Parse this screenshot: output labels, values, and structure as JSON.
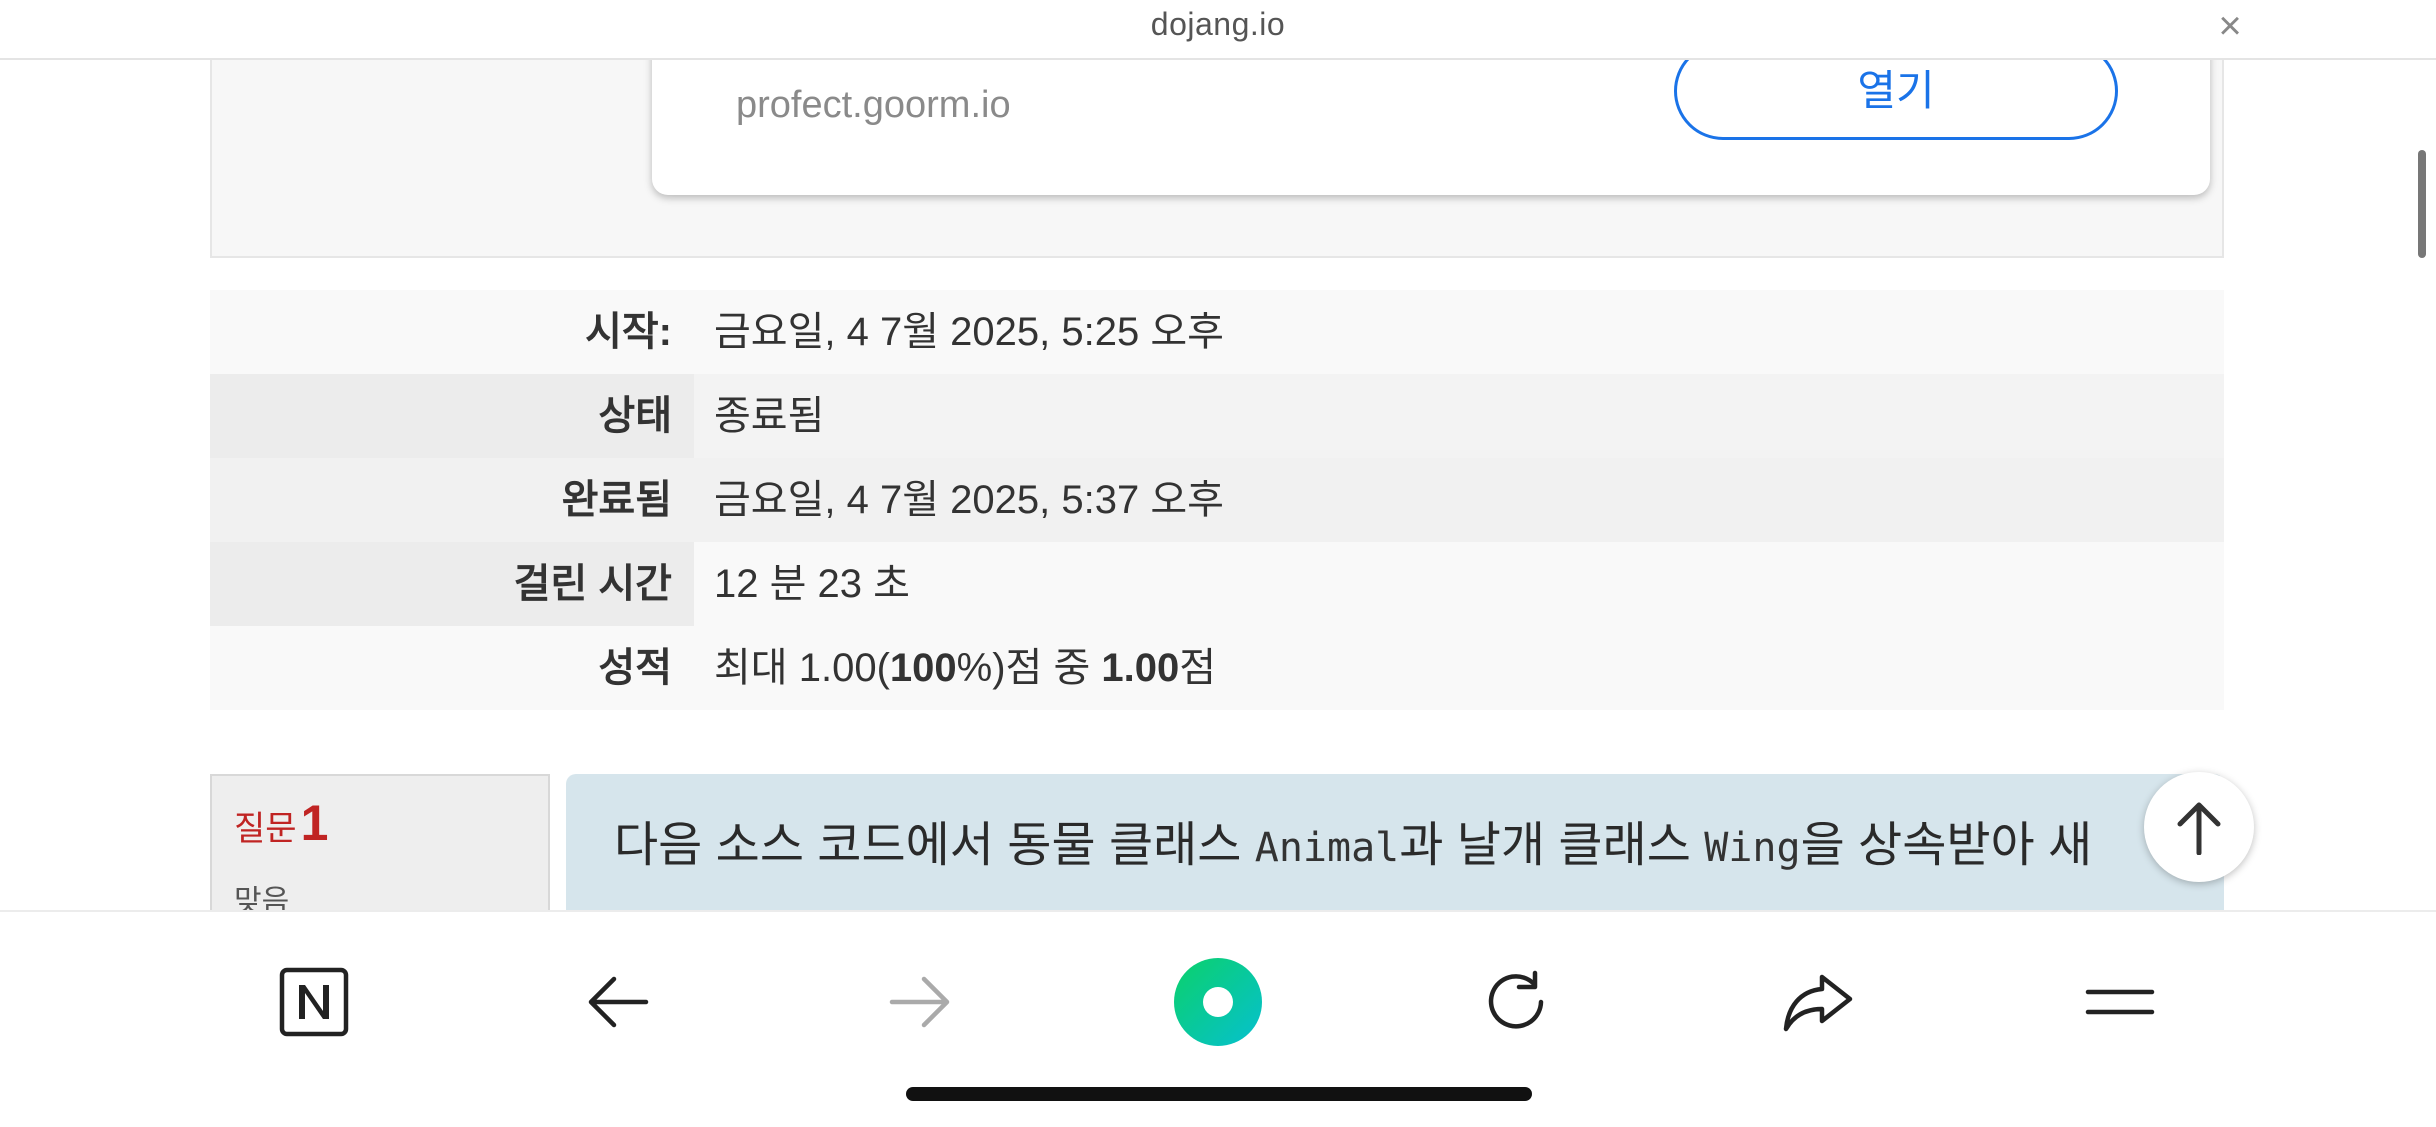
{
  "browser": {
    "url": "dojang.io",
    "close_label": "×"
  },
  "ad": {
    "domain": "profect.goorm.io",
    "open_label": "열기"
  },
  "summary": [
    {
      "label": "시작:",
      "value": "금요일, 4 7월 2025, 5:25 오후"
    },
    {
      "label": "상태",
      "value": "종료됨"
    },
    {
      "label": "완료됨",
      "value": "금요일, 4 7월 2025, 5:37 오후"
    },
    {
      "label": "걸린 시간",
      "value": "12 분 23 초"
    },
    {
      "label": "성적",
      "value_parts": [
        "최대 1.00(",
        "100",
        "%)점 중 ",
        "1.00",
        "점"
      ]
    }
  ],
  "question": {
    "label": "질문",
    "number": "1",
    "status": "맞음",
    "text_parts": [
      "다음 소스 코드에서 동물 클래스 ",
      "Animal",
      "과 날개 클래스 ",
      "Wing",
      "을 상속받아 새"
    ]
  },
  "toolbar": {
    "items": [
      "naver-home-icon",
      "back-icon",
      "forward-icon",
      "green-dot-icon",
      "reload-icon",
      "share-icon",
      "menu-icon"
    ]
  },
  "colors": {
    "accent_blue": "#1a73e8",
    "question_red": "#c02423",
    "question_bg": "#d6e5ec",
    "naver_green": "#03c75a"
  }
}
